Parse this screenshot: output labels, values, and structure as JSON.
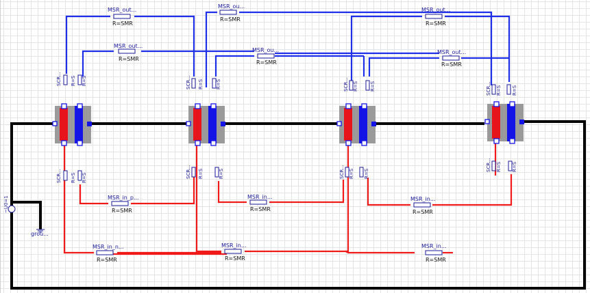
{
  "labels": {
    "msr_out_1": "MSR_out...",
    "msr_out_2": "MSR_ou...",
    "msr_out_3": "MSR_out...",
    "msr_out_4": "MSR_out...",
    "msr_out_5": "MSR_ou...",
    "msr_out_6": "MSR_out...",
    "msr_in_p": "MSR_in_p...",
    "msr_in_2": "MSR_in...",
    "msr_in_3": "MSR_in...",
    "msr_in_n": "MSR_in_n...",
    "msr_in_5": "MSR_in...",
    "msr_in_6": "MSR_in...",
    "r_smr": "R=SMR",
    "scr": "SCR...",
    "rs": "R=S",
    "ground": "grou...",
    "source": "~U0=1"
  },
  "colors": {
    "positive": "#e8141c",
    "negative": "#1414e6",
    "wire_pos": "#f01a1a",
    "wire_neg": "#1f2ee8",
    "bus": "#000000"
  }
}
